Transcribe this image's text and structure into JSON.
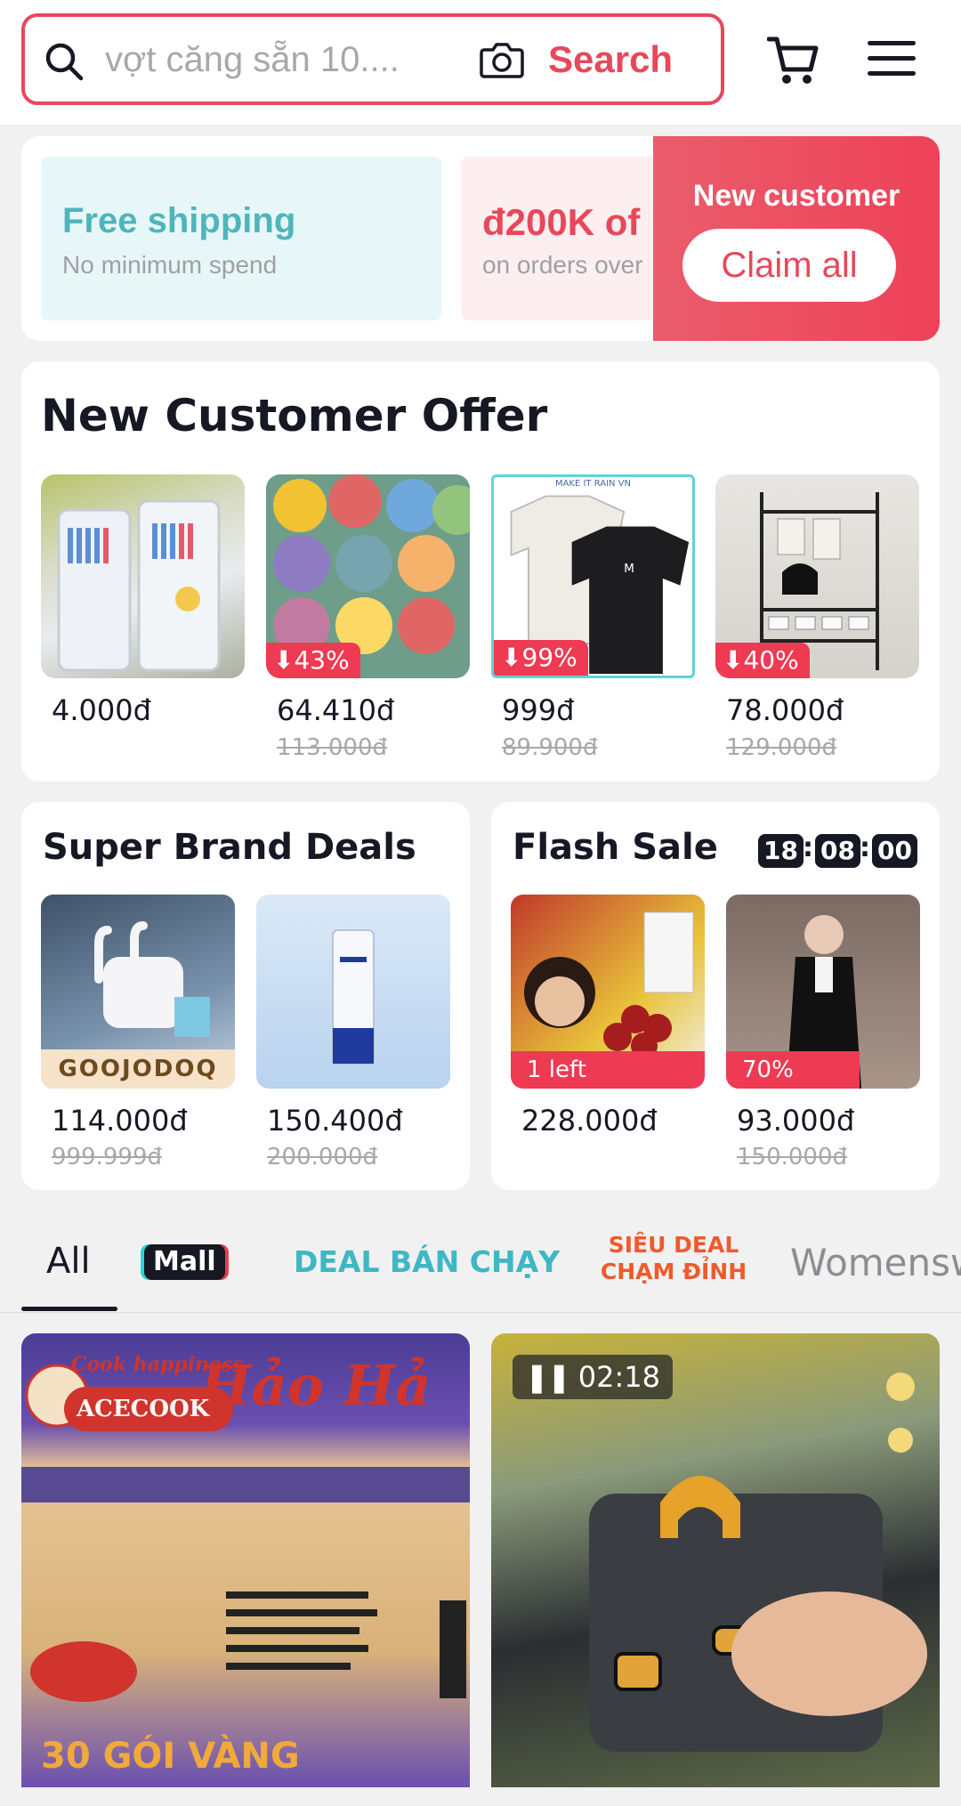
{
  "search": {
    "placeholder": "vợt căng sẵn 10....",
    "button_label": "Search"
  },
  "coupons": {
    "free_shipping": {
      "title": "Free shipping",
      "subtitle": "No minimum spend"
    },
    "discount": {
      "title": "đ200K of",
      "subtitle": "on orders over"
    },
    "claim": {
      "label": "New customer",
      "button": "Claim all"
    }
  },
  "new_customer_offer": {
    "title": "New Customer Offer",
    "items": [
      {
        "price": "4.000đ",
        "original": "",
        "discount": ""
      },
      {
        "price": "64.410đ",
        "original": "113.000đ",
        "discount": "43%"
      },
      {
        "price": "999đ",
        "original": "89.900đ",
        "discount": "99%",
        "overlay_text": "MAKE IT RAIN VN"
      },
      {
        "price": "78.000đ",
        "original": "129.000đ",
        "discount": "40%"
      }
    ]
  },
  "super_brand_deals": {
    "title": "Super Brand Deals",
    "items": [
      {
        "price": "114.000đ",
        "original": "999.999đ",
        "brand": "GOOJODOQ"
      },
      {
        "price": "150.400đ",
        "original": "200.000đ"
      }
    ]
  },
  "flash_sale": {
    "title": "Flash Sale",
    "timer": {
      "hours": "18",
      "minutes": "08",
      "seconds": "00"
    },
    "items": [
      {
        "price": "228.000đ",
        "original": "",
        "label": "1 left"
      },
      {
        "price": "93.000đ",
        "original": "150.000đ",
        "label": "70%"
      }
    ]
  },
  "tabs": {
    "all": "All",
    "mall": "Mall",
    "deal": "DEAL BÁN CHẠY",
    "sieu_deal_1": "SIÊU DEAL",
    "sieu_deal_2": "CHẠM ĐỈNH",
    "womens": "Womensw"
  },
  "feed": [
    {
      "brand": "Hảo Hảo",
      "maker": "ACECOOK",
      "tagline": "Cook happiness"
    },
    {
      "video_duration": "02:18"
    }
  ],
  "colors": {
    "accent": "#e8485a",
    "teal": "#4fb5bc",
    "dark": "#161823"
  }
}
